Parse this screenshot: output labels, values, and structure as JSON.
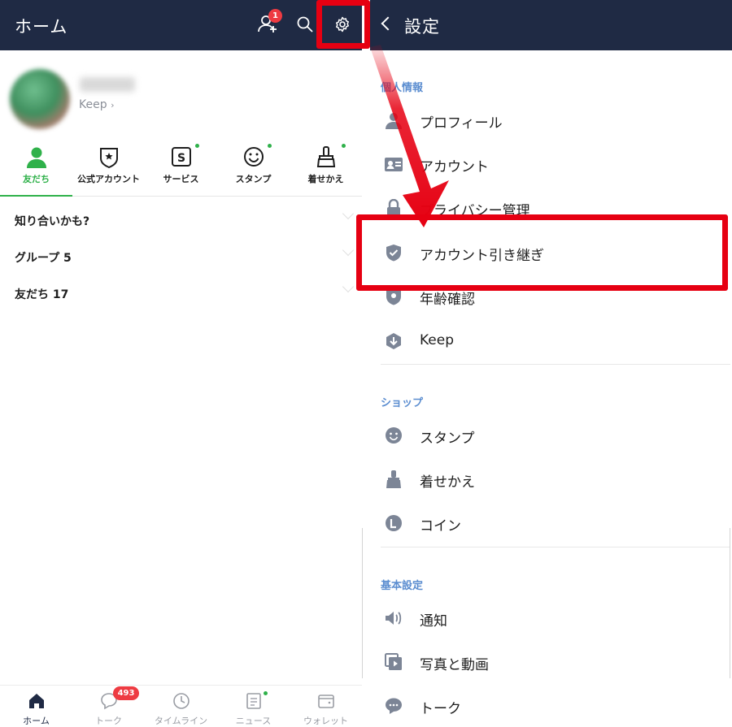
{
  "left": {
    "header": {
      "title": "ホーム",
      "add_friend_badge": "1"
    },
    "profile": {
      "keep_link": "Keep"
    },
    "tabs": [
      {
        "label": "友だち",
        "icon": "person-icon",
        "active": true
      },
      {
        "label": "公式アカウント",
        "icon": "official-badge-icon"
      },
      {
        "label": "サービス",
        "icon": "service-s-icon"
      },
      {
        "label": "スタンプ",
        "icon": "smiley-icon"
      },
      {
        "label": "着せかえ",
        "icon": "brush-icon"
      }
    ],
    "sections": [
      {
        "label": "知り合いかも?"
      },
      {
        "label": "グループ 5"
      },
      {
        "label": "友だち 17"
      }
    ],
    "bottom_nav": [
      {
        "label": "ホーム",
        "icon": "home-icon",
        "active": true
      },
      {
        "label": "トーク",
        "icon": "chat-icon",
        "badge": "493"
      },
      {
        "label": "タイムライン",
        "icon": "clock-icon"
      },
      {
        "label": "ニュース",
        "icon": "news-icon"
      },
      {
        "label": "ウォレット",
        "icon": "wallet-icon"
      }
    ]
  },
  "right": {
    "header": {
      "title": "設定"
    },
    "groups": [
      {
        "title": "個人情報",
        "items": [
          "プロフィール",
          "アカウント",
          "プライバシー管理",
          "アカウント引き継ぎ",
          "年齢確認",
          "Keep"
        ]
      },
      {
        "title": "ショップ",
        "items": [
          "スタンプ",
          "着せかえ",
          "コイン"
        ]
      },
      {
        "title": "基本設定",
        "items": [
          "通知",
          "写真と動画",
          "トーク"
        ]
      }
    ]
  },
  "colors": {
    "header_bg": "#1f2a44",
    "line_green": "#2fb14a",
    "highlight_red": "#e60012",
    "section_blue": "#5b8dd0",
    "badge_red": "#ee3b42"
  }
}
